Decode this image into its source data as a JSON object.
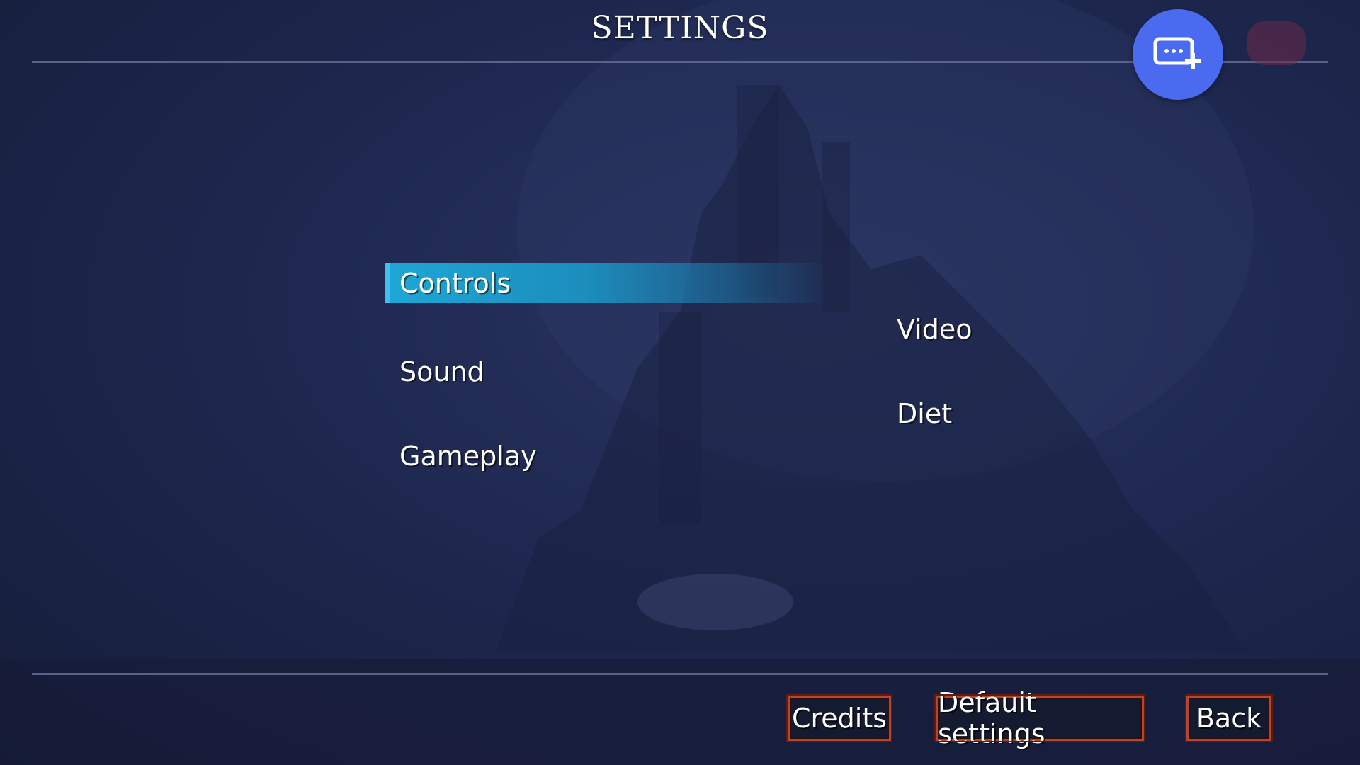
{
  "screen": {
    "title": "SETTINGS"
  },
  "menu": {
    "left": [
      {
        "label": "Controls",
        "selected": true
      },
      {
        "label": "Sound",
        "selected": false
      },
      {
        "label": "Gameplay",
        "selected": false
      }
    ],
    "right": [
      {
        "label": "Video",
        "selected": false
      },
      {
        "label": "Diet",
        "selected": false
      }
    ]
  },
  "footer": {
    "credits_label": "Credits",
    "default_label": "Default settings",
    "back_label": "Back"
  },
  "overlay": {
    "fab_icon": "message-add-icon",
    "gamepad_icon": "gamepad-icon"
  },
  "colors": {
    "accent": "#1fa6d6",
    "fab": "#4a6bf0",
    "button_border": "#b5452f",
    "background": "#1e2850"
  }
}
